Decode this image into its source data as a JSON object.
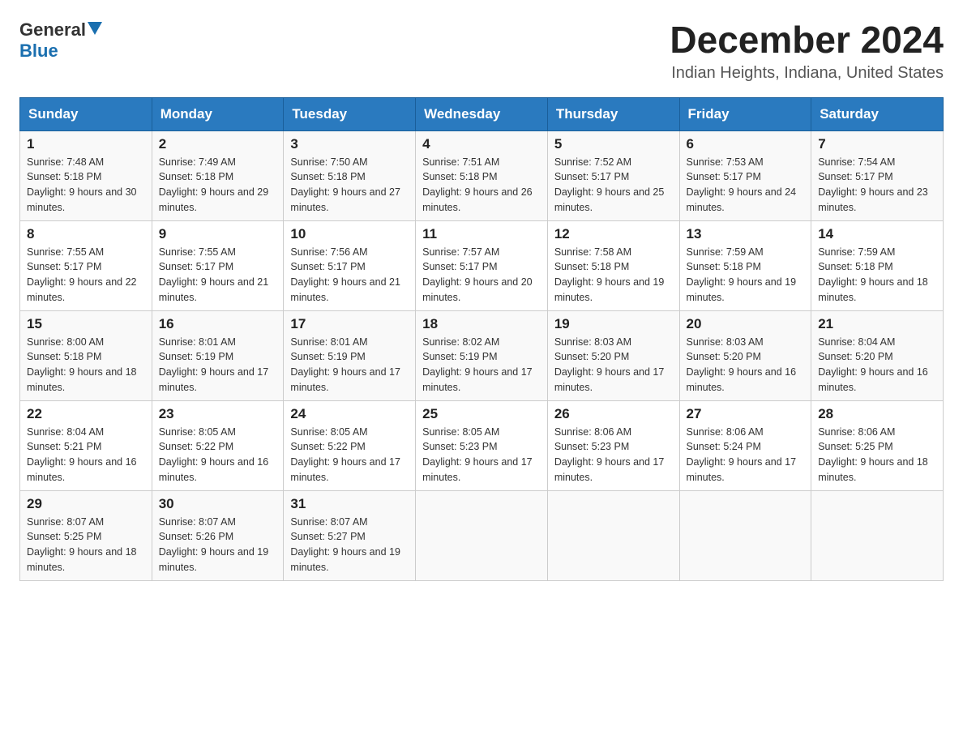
{
  "header": {
    "logo_general": "General",
    "logo_blue": "Blue",
    "title": "December 2024",
    "subtitle": "Indian Heights, Indiana, United States"
  },
  "days_of_week": [
    "Sunday",
    "Monday",
    "Tuesday",
    "Wednesday",
    "Thursday",
    "Friday",
    "Saturday"
  ],
  "weeks": [
    [
      {
        "day": "1",
        "sunrise": "7:48 AM",
        "sunset": "5:18 PM",
        "daylight": "9 hours and 30 minutes."
      },
      {
        "day": "2",
        "sunrise": "7:49 AM",
        "sunset": "5:18 PM",
        "daylight": "9 hours and 29 minutes."
      },
      {
        "day": "3",
        "sunrise": "7:50 AM",
        "sunset": "5:18 PM",
        "daylight": "9 hours and 27 minutes."
      },
      {
        "day": "4",
        "sunrise": "7:51 AM",
        "sunset": "5:18 PM",
        "daylight": "9 hours and 26 minutes."
      },
      {
        "day": "5",
        "sunrise": "7:52 AM",
        "sunset": "5:17 PM",
        "daylight": "9 hours and 25 minutes."
      },
      {
        "day": "6",
        "sunrise": "7:53 AM",
        "sunset": "5:17 PM",
        "daylight": "9 hours and 24 minutes."
      },
      {
        "day": "7",
        "sunrise": "7:54 AM",
        "sunset": "5:17 PM",
        "daylight": "9 hours and 23 minutes."
      }
    ],
    [
      {
        "day": "8",
        "sunrise": "7:55 AM",
        "sunset": "5:17 PM",
        "daylight": "9 hours and 22 minutes."
      },
      {
        "day": "9",
        "sunrise": "7:55 AM",
        "sunset": "5:17 PM",
        "daylight": "9 hours and 21 minutes."
      },
      {
        "day": "10",
        "sunrise": "7:56 AM",
        "sunset": "5:17 PM",
        "daylight": "9 hours and 21 minutes."
      },
      {
        "day": "11",
        "sunrise": "7:57 AM",
        "sunset": "5:17 PM",
        "daylight": "9 hours and 20 minutes."
      },
      {
        "day": "12",
        "sunrise": "7:58 AM",
        "sunset": "5:18 PM",
        "daylight": "9 hours and 19 minutes."
      },
      {
        "day": "13",
        "sunrise": "7:59 AM",
        "sunset": "5:18 PM",
        "daylight": "9 hours and 19 minutes."
      },
      {
        "day": "14",
        "sunrise": "7:59 AM",
        "sunset": "5:18 PM",
        "daylight": "9 hours and 18 minutes."
      }
    ],
    [
      {
        "day": "15",
        "sunrise": "8:00 AM",
        "sunset": "5:18 PM",
        "daylight": "9 hours and 18 minutes."
      },
      {
        "day": "16",
        "sunrise": "8:01 AM",
        "sunset": "5:19 PM",
        "daylight": "9 hours and 17 minutes."
      },
      {
        "day": "17",
        "sunrise": "8:01 AM",
        "sunset": "5:19 PM",
        "daylight": "9 hours and 17 minutes."
      },
      {
        "day": "18",
        "sunrise": "8:02 AM",
        "sunset": "5:19 PM",
        "daylight": "9 hours and 17 minutes."
      },
      {
        "day": "19",
        "sunrise": "8:03 AM",
        "sunset": "5:20 PM",
        "daylight": "9 hours and 17 minutes."
      },
      {
        "day": "20",
        "sunrise": "8:03 AM",
        "sunset": "5:20 PM",
        "daylight": "9 hours and 16 minutes."
      },
      {
        "day": "21",
        "sunrise": "8:04 AM",
        "sunset": "5:20 PM",
        "daylight": "9 hours and 16 minutes."
      }
    ],
    [
      {
        "day": "22",
        "sunrise": "8:04 AM",
        "sunset": "5:21 PM",
        "daylight": "9 hours and 16 minutes."
      },
      {
        "day": "23",
        "sunrise": "8:05 AM",
        "sunset": "5:22 PM",
        "daylight": "9 hours and 16 minutes."
      },
      {
        "day": "24",
        "sunrise": "8:05 AM",
        "sunset": "5:22 PM",
        "daylight": "9 hours and 17 minutes."
      },
      {
        "day": "25",
        "sunrise": "8:05 AM",
        "sunset": "5:23 PM",
        "daylight": "9 hours and 17 minutes."
      },
      {
        "day": "26",
        "sunrise": "8:06 AM",
        "sunset": "5:23 PM",
        "daylight": "9 hours and 17 minutes."
      },
      {
        "day": "27",
        "sunrise": "8:06 AM",
        "sunset": "5:24 PM",
        "daylight": "9 hours and 17 minutes."
      },
      {
        "day": "28",
        "sunrise": "8:06 AM",
        "sunset": "5:25 PM",
        "daylight": "9 hours and 18 minutes."
      }
    ],
    [
      {
        "day": "29",
        "sunrise": "8:07 AM",
        "sunset": "5:25 PM",
        "daylight": "9 hours and 18 minutes."
      },
      {
        "day": "30",
        "sunrise": "8:07 AM",
        "sunset": "5:26 PM",
        "daylight": "9 hours and 19 minutes."
      },
      {
        "day": "31",
        "sunrise": "8:07 AM",
        "sunset": "5:27 PM",
        "daylight": "9 hours and 19 minutes."
      },
      null,
      null,
      null,
      null
    ]
  ]
}
